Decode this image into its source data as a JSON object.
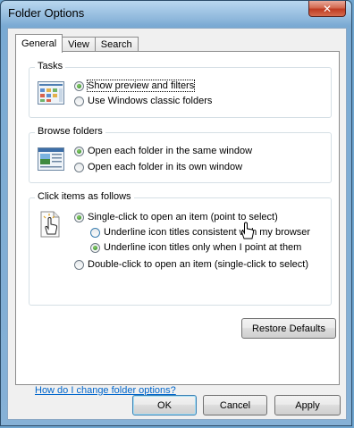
{
  "window": {
    "title": "Folder Options",
    "close_label": "✕"
  },
  "tabs": [
    {
      "label": "General",
      "active": true
    },
    {
      "label": "View",
      "active": false
    },
    {
      "label": "Search",
      "active": false
    }
  ],
  "tasks": {
    "title": "Tasks",
    "options": [
      {
        "label": "Show preview and filters",
        "checked": true
      },
      {
        "label": "Use Windows classic folders",
        "checked": false
      }
    ]
  },
  "browse": {
    "title": "Browse folders",
    "options": [
      {
        "label": "Open each folder in the same window",
        "checked": true
      },
      {
        "label": "Open each folder in its own window",
        "checked": false
      }
    ]
  },
  "click_items": {
    "title": "Click items as follows",
    "options": [
      {
        "label": "Single-click to open an item (point to select)",
        "checked": true
      },
      {
        "label": "Underline icon titles consistent with my browser",
        "checked": false
      },
      {
        "label": "Underline icon titles only when I point at them",
        "checked": true
      },
      {
        "label": "Double-click to open an item (single-click to select)",
        "checked": false
      }
    ]
  },
  "restore_defaults_label": "Restore Defaults",
  "help_link": "How do I change folder options?",
  "buttons": {
    "ok": "OK",
    "cancel": "Cancel",
    "apply": "Apply"
  },
  "colors": {
    "link": "#0066cc",
    "titlebar": "#7aaad3",
    "close": "#c9462b"
  }
}
